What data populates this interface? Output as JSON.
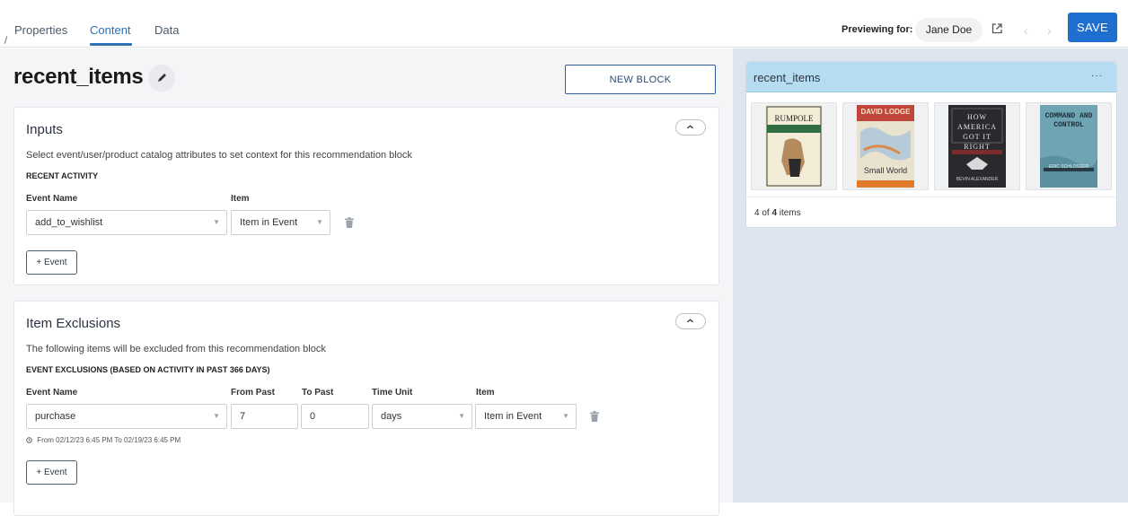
{
  "tabs": [
    {
      "label": "Properties"
    },
    {
      "label": "Content"
    },
    {
      "label": "Data"
    }
  ],
  "header": {
    "previewing_label": "Previewing for:",
    "user_name": "Jane Doe",
    "save_label": "SAVE",
    "accent_color": "#1f6fd1"
  },
  "block": {
    "title": "recent_items",
    "new_block_label": "NEW BLOCK"
  },
  "inputs": {
    "title": "Inputs",
    "description": "Select event/user/product catalog attributes to set context for this recommendation block",
    "section_heading": "RECENT ACTIVITY",
    "columns": {
      "event_name": "Event Name",
      "item": "Item"
    },
    "row": {
      "event_name": "add_to_wishlist",
      "item": "Item in Event"
    },
    "add_event_label": "+ Event"
  },
  "exclusions": {
    "title": "Item Exclusions",
    "description": "The following items will be excluded from this recommendation block",
    "section_heading": "EVENT EXCLUSIONS (BASED ON ACTIVITY IN PAST 366 DAYS)",
    "columns": {
      "event_name": "Event Name",
      "from_past": "From Past",
      "to_past": "To Past",
      "time_unit": "Time Unit",
      "item": "Item"
    },
    "row": {
      "event_name": "purchase",
      "from_past": "7",
      "to_past": "0",
      "time_unit": "days",
      "item": "Item in Event"
    },
    "range_note": "From 02/12/23 6:45 PM To 02/19/23 6:45 PM",
    "add_event_label": "+ Event"
  },
  "preview": {
    "title": "recent_items",
    "more_label": "···",
    "count_shown": "4",
    "count_mid": " of ",
    "count_total": "4",
    "count_suffix": " items",
    "books": [
      {
        "title": "RUMPOLE",
        "subtitle": "FOR THE DEFENCE",
        "author": "JOHN MORTIMER",
        "cover_color": "#f3ecd6"
      },
      {
        "title": "Small World",
        "author": "DAVID LODGE",
        "cover_color": "#e9e2cf"
      },
      {
        "title": "HOW AMERICA GOT IT RIGHT",
        "author": "BEVIN ALEXANDER",
        "cover_color": "#2a2a2e"
      },
      {
        "title": "COMMAND AND CONTROL",
        "author": "ERIC SCHLOSSER",
        "cover_color": "#6fa4b3"
      }
    ]
  }
}
